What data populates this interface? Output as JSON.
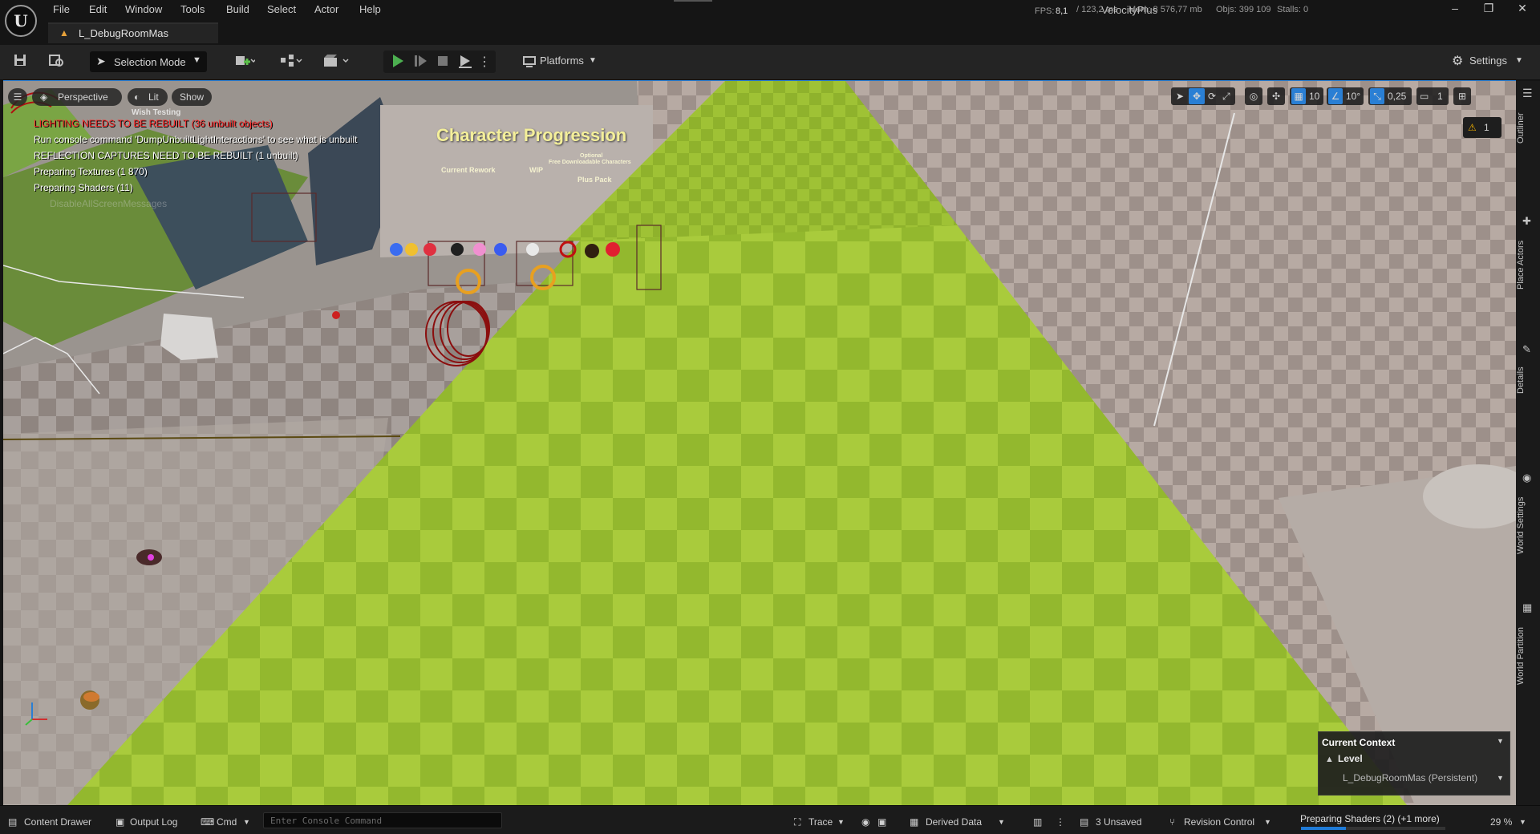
{
  "menu": {
    "items": [
      "File",
      "Edit",
      "Window",
      "Tools",
      "Build",
      "Select",
      "Actor",
      "Help"
    ]
  },
  "tab": {
    "level_name": "L_DebugRoomMas"
  },
  "stats": {
    "fps_label": "FPS:",
    "fps": "8,1",
    "ms": "/ 123,2 ms",
    "mem": "Mem: 8 576,77 mb",
    "objs": "Objs: 399 109",
    "stalls": "Stalls: 0"
  },
  "project": {
    "name": "VelocityPlus"
  },
  "window_controls": {
    "minimize": "–",
    "restore": "❐",
    "close": "✕"
  },
  "toolbar": {
    "selection_mode": "Selection Mode",
    "platforms": "Platforms",
    "settings": "Settings"
  },
  "viewport": {
    "perspective": "Perspective",
    "lit": "Lit",
    "show": "Show",
    "grid_snap": "10",
    "rot_snap": "10°",
    "scale_snap": "0,25",
    "camera_speed": "1",
    "warning_count": "1"
  },
  "overlay": {
    "lighting": "LIGHTING NEEDS TO BE REBUILT (36 unbuilt objects)",
    "console_hint": "Run console command 'DumpUnbuiltLightInteractions' to see what is unbuilt",
    "reflection": "REFLECTION CAPTURES NEED TO BE REBUILT (1 unbuilt)",
    "textures": "Preparing Textures (1     870)",
    "shaders": "Preparing Shaders (11)",
    "faded": "DisableAllScreenMessages"
  },
  "scene": {
    "sign_title": "Character Progression",
    "current_rework": "Current Rework",
    "wip": "WIP",
    "optional": "Optional",
    "free_dlc": "Free Downloadable Characters",
    "plus_pack": "Plus Pack",
    "poster_title": "Wish Testing"
  },
  "side_tabs": {
    "outliner": "Outliner",
    "place_actors": "Place Actors",
    "details": "Details",
    "world_settings": "World Settings",
    "world_partition": "World Partition"
  },
  "context": {
    "title": "Current Context",
    "level_label": "Level",
    "level_value": "L_DebugRoomMas (Persistent)"
  },
  "statusbar": {
    "content_drawer": "Content Drawer",
    "output_log": "Output Log",
    "cmd": "Cmd",
    "console_placeholder": "Enter Console Command",
    "trace": "Trace",
    "derived_data": "Derived Data",
    "unsaved": "3 Unsaved",
    "revision_control": "Revision Control",
    "preparing": "Preparing Shaders (2) (+1 more)",
    "percent": "29 %",
    "progress": 0.31
  },
  "colors": {
    "accent": "#2a7fd4",
    "warning_red": "#ff2a2a",
    "grass": "#a6c93a",
    "sign_yellow": "#f4ef9a",
    "play_green": "#4caf50"
  }
}
